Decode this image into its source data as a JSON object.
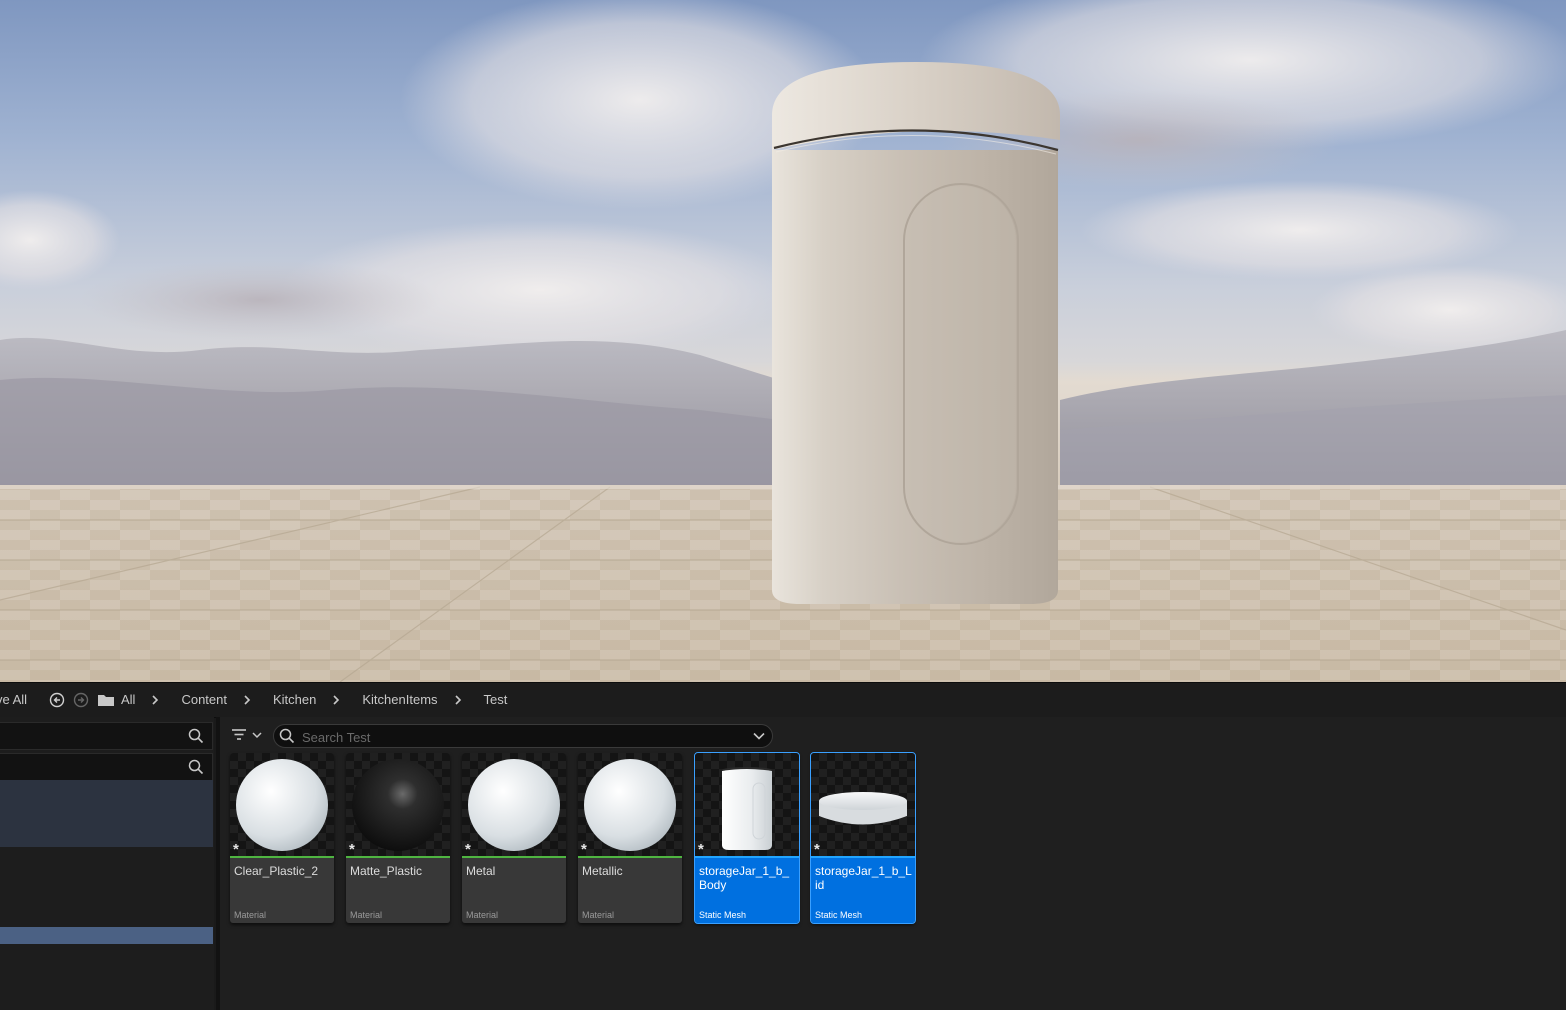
{
  "toolbar": {
    "save_all_label": "ve All"
  },
  "breadcrumb": {
    "items": [
      "All",
      "Content",
      "Kitchen",
      "KitchenItems",
      "Test"
    ]
  },
  "search": {
    "placeholder": "Search Test"
  },
  "assets": [
    {
      "name": "Clear_Plastic_2",
      "type": "Material",
      "selected": false,
      "thumb": "white-sphere"
    },
    {
      "name": "Matte_Plastic",
      "type": "Material",
      "selected": false,
      "thumb": "black-sphere"
    },
    {
      "name": "Metal",
      "type": "Material",
      "selected": false,
      "thumb": "white-sphere"
    },
    {
      "name": "Metallic",
      "type": "Material",
      "selected": false,
      "thumb": "white-sphere"
    },
    {
      "name": "storageJar_1_b_Body",
      "type": "Static Mesh",
      "selected": true,
      "thumb": "jar-body"
    },
    {
      "name": "storageJar_1_b_Lid",
      "type": "Static Mesh",
      "selected": true,
      "thumb": "jar-lid"
    }
  ],
  "colors": {
    "selection": "#0070e0",
    "material_bar": "#4fb541",
    "mesh_bar": "#22a5ff",
    "panel_bg": "#1f1f1f"
  },
  "icons": {
    "back": "arrow-left-circle-icon",
    "forward": "arrow-right-circle-icon",
    "folder": "folder-icon",
    "search": "search-icon",
    "filter": "filter-icon",
    "chevron": "chevron-down-icon",
    "breadcrumb_separator": "chevron-right-icon",
    "asset_modified": "asterisk-icon"
  }
}
